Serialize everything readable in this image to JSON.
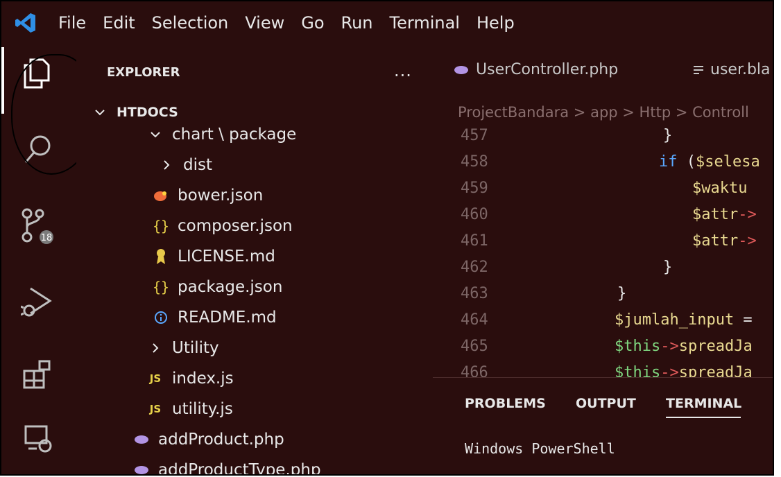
{
  "menu": [
    "File",
    "Edit",
    "Selection",
    "View",
    "Go",
    "Run",
    "Terminal",
    "Help"
  ],
  "activity_bar": {
    "explorer_icon": "files-icon",
    "search_icon": "search-icon",
    "source_control_icon": "source-control-icon",
    "source_control_badge": "18",
    "run_debug_icon": "run-debug-icon",
    "extensions_icon": "extensions-icon",
    "remote_icon": "remote-explorer-icon"
  },
  "sidebar": {
    "title": "EXPLORER",
    "more": "...",
    "root": "HTDOCS",
    "items": [
      {
        "label": "chart \\ package",
        "icon": "chevron-down-icon"
      },
      {
        "label": "dist",
        "icon": "chevron-right-icon"
      },
      {
        "label": "bower.json",
        "icon": "bower-icon"
      },
      {
        "label": "composer.json",
        "icon": "json-icon"
      },
      {
        "label": "LICENSE.md",
        "icon": "license-icon"
      },
      {
        "label": "package.json",
        "icon": "json-icon"
      },
      {
        "label": "README.md",
        "icon": "info-icon"
      },
      {
        "label": "Utility",
        "icon": "chevron-right-icon"
      },
      {
        "label": "index.js",
        "icon": "js-icon"
      },
      {
        "label": "utility.js",
        "icon": "js-icon"
      },
      {
        "label": "addProduct.php",
        "icon": "php-icon"
      },
      {
        "label": "addProductType.php",
        "icon": "php-icon"
      }
    ]
  },
  "tabs": [
    {
      "label": "UserController.php",
      "icon": "php-icon"
    },
    {
      "label": "user.bla",
      "icon": "menu-lines-icon"
    }
  ],
  "breadcrumb": "ProjectBandara > app > Http > Controll",
  "code": [
    {
      "ln": "457",
      "text": "            }"
    },
    {
      "ln": "458",
      "text": "            if ($selesa"
    },
    {
      "ln": "459",
      "text": "               $waktu"
    },
    {
      "ln": "460",
      "text": "               $attr->"
    },
    {
      "ln": "461",
      "text": "               $attr->"
    },
    {
      "ln": "462",
      "text": "            }"
    },
    {
      "ln": "463",
      "text": "        }"
    },
    {
      "ln": "464",
      "text": "        $jumlah_input ="
    },
    {
      "ln": "465",
      "text": "        $this->spreadJa"
    },
    {
      "ln": "466",
      "text": "        $this->spreadJa"
    }
  ],
  "panel": {
    "tabs": [
      "PROBLEMS",
      "OUTPUT",
      "TERMINAL"
    ],
    "active": "TERMINAL",
    "terminal_text": "Windows PowerShell"
  },
  "colors": {
    "background": "#2a0d0d",
    "keyword": "#5aa8ff",
    "variable": "#e8d890",
    "operator": "#e05a5a",
    "php_purple": "#b394e4",
    "js_yellow": "#e8d14a"
  }
}
